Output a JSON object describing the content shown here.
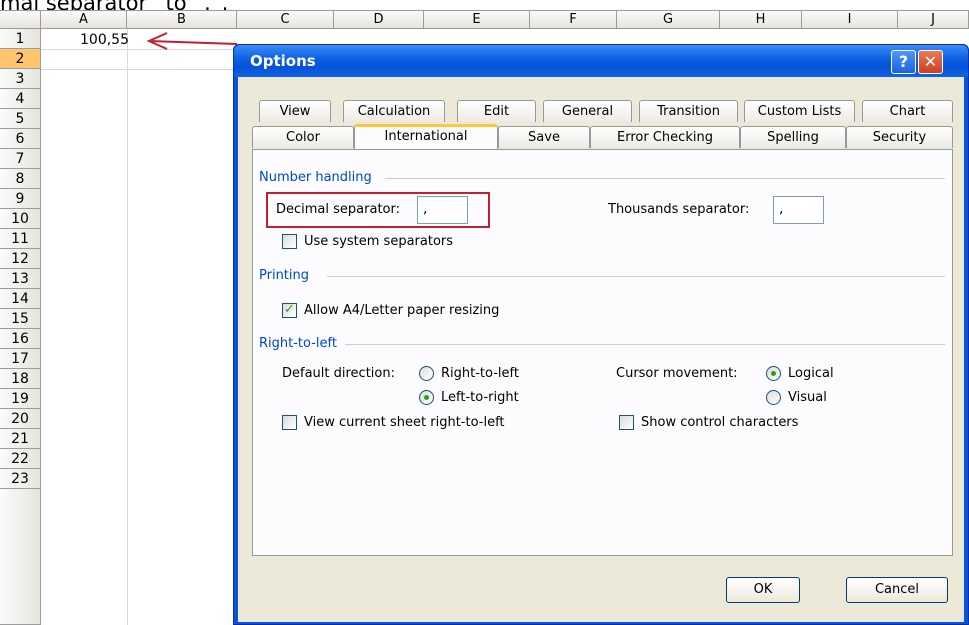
{
  "caption": "mal separator” to “.”.",
  "spreadsheet": {
    "columns": [
      "A",
      "B",
      "C",
      "D",
      "E",
      "F",
      "G",
      "H",
      "I",
      "J"
    ],
    "rows": [
      "1",
      "2",
      "3",
      "4",
      "5",
      "6",
      "7",
      "8",
      "9",
      "10",
      "11",
      "12",
      "13",
      "14",
      "15",
      "16",
      "17",
      "18",
      "19",
      "20",
      "21",
      "22",
      "23"
    ],
    "active_row": "2",
    "cell_a1": "100,55"
  },
  "dialog": {
    "title": "Options",
    "help_glyph": "?",
    "close_glyph": "✕",
    "tabs_row1": [
      "View",
      "Calculation",
      "Edit",
      "General",
      "Transition",
      "Custom Lists",
      "Chart"
    ],
    "tabs_row2": [
      "Color",
      "International",
      "Save",
      "Error Checking",
      "Spelling",
      "Security"
    ],
    "selected_tab": "International",
    "number_handling": {
      "heading": "Number handling",
      "decimal_label": "Decimal separator:",
      "decimal_value": ",",
      "thousands_label": "Thousands separator:",
      "thousands_value": ",",
      "use_system_label": "Use system separators",
      "use_system_checked": false
    },
    "printing": {
      "heading": "Printing",
      "allow_resize_label": "Allow A4/Letter paper resizing",
      "allow_resize_checked": true
    },
    "rtl": {
      "heading": "Right-to-left",
      "default_direction_label": "Default direction:",
      "opt_rtl": "Right-to-left",
      "opt_ltr": "Left-to-right",
      "default_direction_selected": "Left-to-right",
      "cursor_movement_label": "Cursor movement:",
      "opt_logical": "Logical",
      "opt_visual": "Visual",
      "cursor_selected": "Logical",
      "view_rtl_label": "View current sheet right-to-left",
      "view_rtl_checked": false,
      "show_control_label": "Show control characters",
      "show_control_checked": false
    },
    "ok_label": "OK",
    "cancel_label": "Cancel"
  },
  "colors": {
    "highlight": "#c02030",
    "title_bar": "#0a5fe3",
    "group_heading": "#0046d5",
    "active_tab": "#ffc83c",
    "active_row_header": "#ffc56e"
  }
}
